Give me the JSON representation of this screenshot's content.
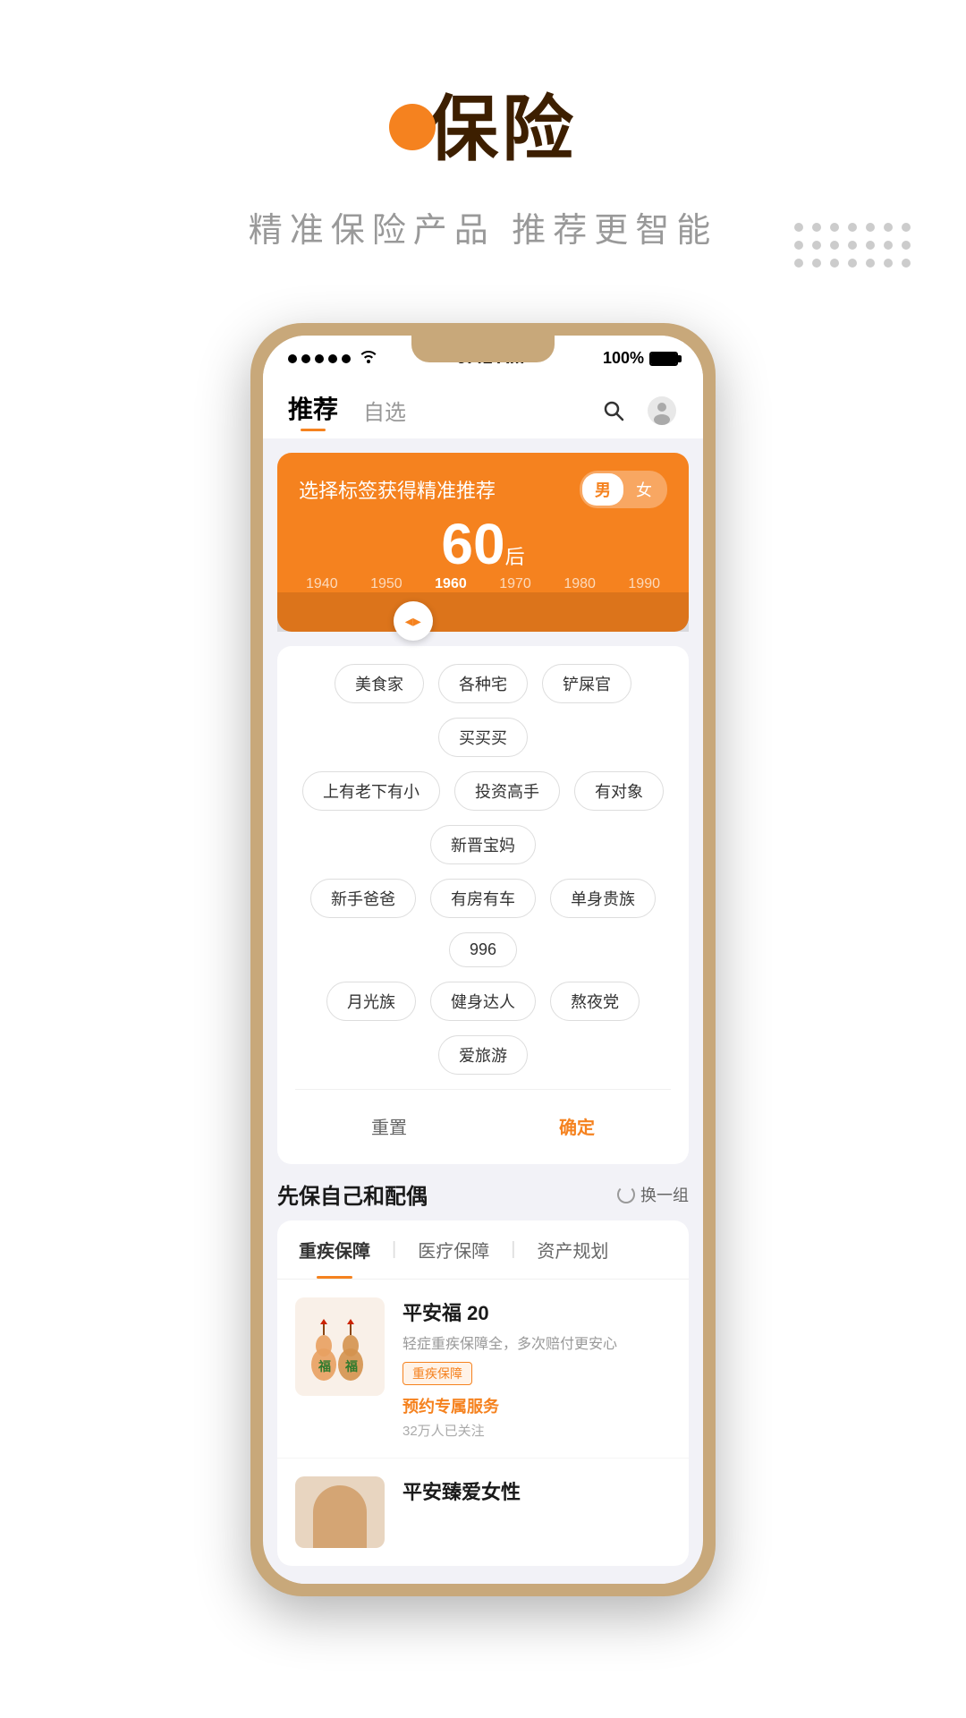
{
  "header": {
    "logo_dot": "orange-circle",
    "title": "保险",
    "subtitle": "精准保险产品   推荐更智能"
  },
  "status_bar": {
    "time": "9:41 AM",
    "battery": "100%",
    "signal": "●●●●●",
    "wifi": "WiFi"
  },
  "nav": {
    "tabs": [
      {
        "label": "推荐",
        "active": true
      },
      {
        "label": "自选",
        "active": false
      }
    ],
    "icons": [
      "search",
      "avatar"
    ]
  },
  "orange_panel": {
    "title": "选择标签获得精准推荐",
    "gender_options": [
      {
        "label": "男",
        "active": true
      },
      {
        "label": "女",
        "active": false
      }
    ],
    "decade_number": "60",
    "decade_suffix": "后",
    "decades": [
      {
        "label": "1940",
        "active": false
      },
      {
        "label": "1950",
        "active": false
      },
      {
        "label": "1960",
        "active": true
      },
      {
        "label": "1970",
        "active": false
      },
      {
        "label": "1980",
        "active": false
      },
      {
        "label": "1990",
        "active": false
      }
    ]
  },
  "tags": {
    "rows": [
      [
        "美食家",
        "各种宅",
        "铲屎官",
        "买买买"
      ],
      [
        "上有老下有小",
        "投资高手",
        "有对象",
        "新晋宝妈"
      ],
      [
        "新手爸爸",
        "有房有车",
        "单身贵族",
        "996"
      ],
      [
        "月光族",
        "健身达人",
        "熬夜党",
        "爱旅游"
      ]
    ],
    "reset_label": "重置",
    "confirm_label": "确定"
  },
  "products_section": {
    "title": "先保自己和配偶",
    "action_label": "换一组",
    "tabs": [
      {
        "label": "重疾保障",
        "active": true
      },
      {
        "label": "医疗保障",
        "active": false
      },
      {
        "label": "资产规划",
        "active": false
      }
    ],
    "items": [
      {
        "name": "平安福 20",
        "desc": "轻症重疾保障全，多次赔付更安心",
        "tag": "重疾保障",
        "action": "预约专属服务",
        "followers": "32万人已关注"
      },
      {
        "name": "平安臻爱女性",
        "desc": "",
        "tag": "",
        "action": "",
        "followers": ""
      }
    ]
  }
}
